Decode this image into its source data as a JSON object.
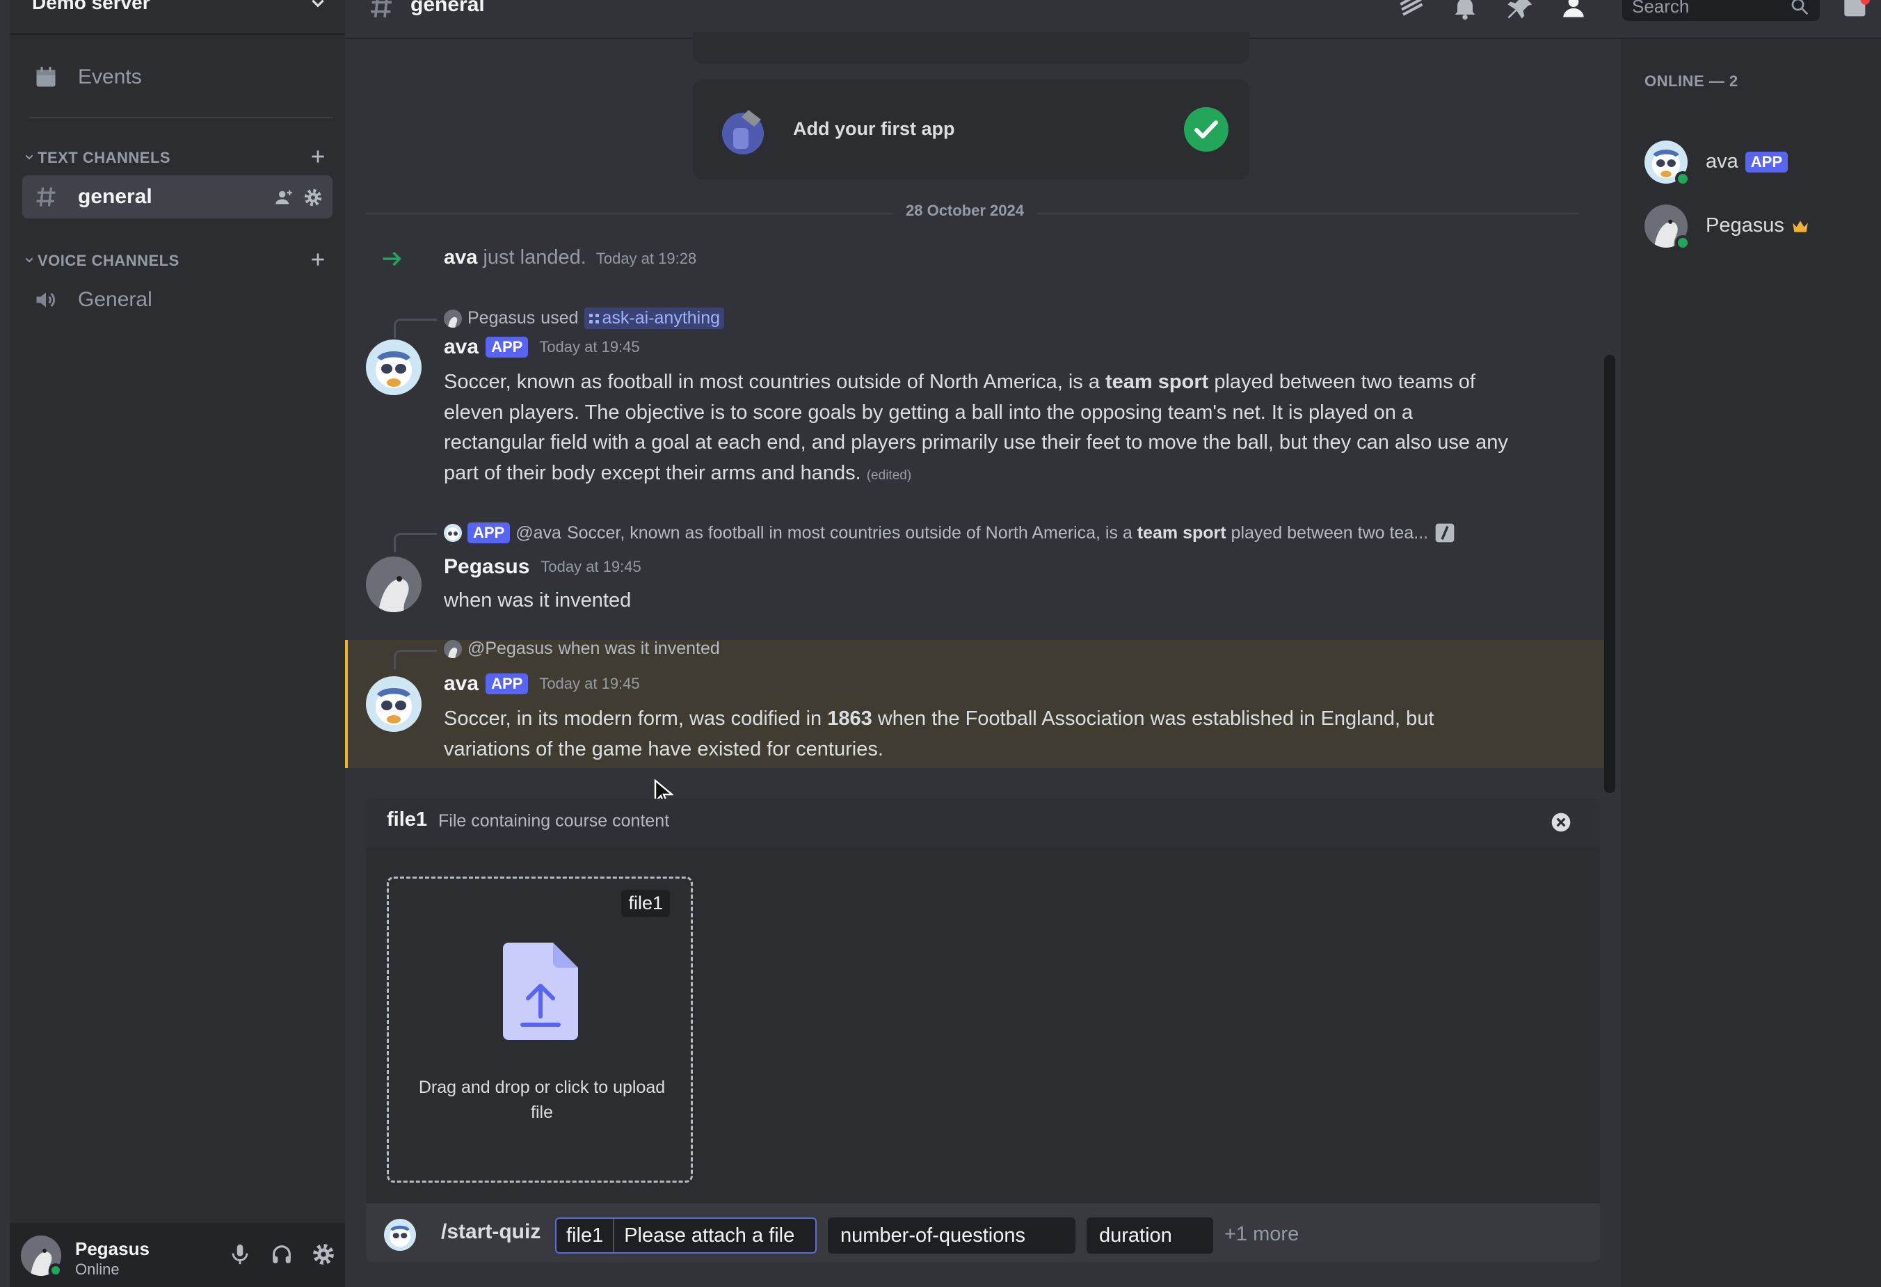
{
  "server": {
    "name": "Demo server"
  },
  "sidebar": {
    "events_label": "Events",
    "categories": [
      {
        "label": "TEXT CHANNELS",
        "channels": [
          {
            "label": "general",
            "selected": true
          }
        ]
      },
      {
        "label": "VOICE CHANNELS",
        "channels": [
          {
            "label": "General"
          }
        ]
      }
    ]
  },
  "user_panel": {
    "name": "Pegasus",
    "status": "Online"
  },
  "topbar": {
    "channel": "general",
    "search_placeholder": "Search"
  },
  "checklist": {
    "item_label": "Add your first app",
    "completed": true
  },
  "date_divider": "28 October 2024",
  "join_message": {
    "user": "ava",
    "text": "just landed.",
    "timestamp": "Today at 19:28"
  },
  "messages": [
    {
      "reply": {
        "user": "Pegasus",
        "used_text": "used",
        "command": "ask-ai-anything"
      },
      "author": "ava",
      "tag": "APP",
      "timestamp": "Today at 19:45",
      "body_parts": [
        "Soccer, known as football in most countries outside of North America, is a ",
        "team sport",
        " played between two teams of eleven players. The objective is to score goals by getting a ball into the opposing team's net. It is played on a rectangular field with a goal at each end, and players primarily use their feet to move the ball, but they can also use any part of their body except their arms and hands."
      ],
      "edited": "(edited)"
    },
    {
      "reply": {
        "tag": "APP",
        "mention": "@ava",
        "text_a": "Soccer, known as football in most countries outside of North America, is a ",
        "bold": "team sport",
        "text_b": " played between two tea..."
      },
      "author": "Pegasus",
      "timestamp": "Today at 19:45",
      "body": "when was it invented"
    },
    {
      "reply": {
        "mention": "@Pegasus",
        "text": "when was it invented"
      },
      "author": "ava",
      "tag": "APP",
      "timestamp": "Today at 19:45",
      "body_parts": [
        "Soccer, in its modern form, was codified in ",
        "1863",
        " when the Football Association was established in England, but variations of the game have existed for centuries."
      ],
      "highlighted": true
    }
  ],
  "upload_panel": {
    "option_name": "file1",
    "option_description": "File containing course content",
    "dropzone_tag": "file1",
    "dropzone_text": "Drag and drop or click to upload file"
  },
  "command_bar": {
    "command": "/start-quiz",
    "options": [
      {
        "name": "file1",
        "value": "Please attach a file",
        "active": true
      },
      {
        "name": "number-of-questions"
      },
      {
        "name": "duration"
      }
    ],
    "more": "+1 more"
  },
  "members": {
    "header": "ONLINE — 2",
    "list": [
      {
        "name": "ava",
        "tag": "APP",
        "status": "online"
      },
      {
        "name": "Pegasus",
        "owner": true,
        "status": "online"
      }
    ]
  },
  "colors": {
    "accent": "#5865f2",
    "online": "#23a55a",
    "highlight_border": "#f0b232",
    "highlight_bg": "#413c32"
  },
  "icons": [
    "chevron-down-icon",
    "calendar-icon",
    "hash-icon",
    "plus-icon",
    "add-member-icon",
    "gear-icon",
    "speaker-icon",
    "mic-icon",
    "headphones-icon",
    "threads-icon",
    "bell-icon",
    "pin-icon",
    "members-icon",
    "search-icon",
    "inbox-icon",
    "arrow-right-icon",
    "check-icon",
    "upload-file-icon",
    "close-circle-icon",
    "crown-icon",
    "slash-icon"
  ]
}
